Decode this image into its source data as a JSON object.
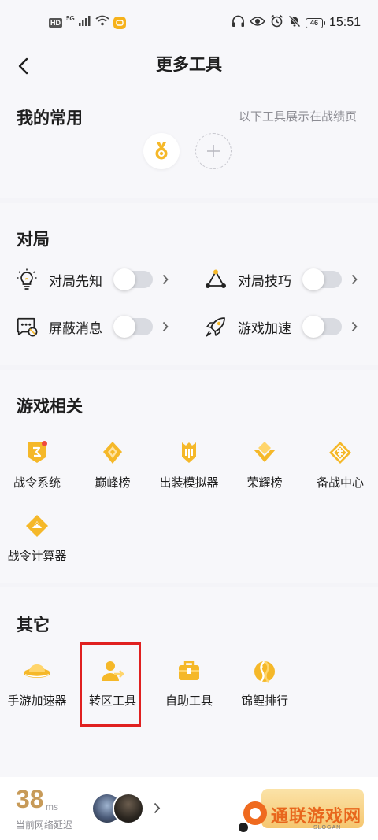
{
  "status_bar": {
    "hd": "HD",
    "net": "5G",
    "battery": "46",
    "time": "15:51"
  },
  "nav": {
    "title": "更多工具"
  },
  "favorites": {
    "title": "我的常用",
    "hint": "以下工具展示在战绩页"
  },
  "match": {
    "title": "对局",
    "rows": [
      {
        "label": "对局先知",
        "icon": "bulb-icon",
        "enabled": false
      },
      {
        "label": "对局技巧",
        "icon": "triangle-nodes-icon",
        "enabled": false
      },
      {
        "label": "屏蔽消息",
        "icon": "blocked-message-icon",
        "enabled": false
      },
      {
        "label": "游戏加速",
        "icon": "rocket-icon",
        "enabled": false
      }
    ]
  },
  "game_related": {
    "title": "游戏相关",
    "items": [
      {
        "label": "战令系统",
        "icon": "battle-pass-icon",
        "badge": true
      },
      {
        "label": "巅峰榜",
        "icon": "peak-rank-icon"
      },
      {
        "label": "出装模拟器",
        "icon": "build-simulator-icon"
      },
      {
        "label": "荣耀榜",
        "icon": "glory-rank-icon"
      },
      {
        "label": "备战中心",
        "icon": "prep-center-icon"
      },
      {
        "label": "战令计算器",
        "icon": "pass-calculator-icon"
      }
    ]
  },
  "others": {
    "title": "其它",
    "items": [
      {
        "label": "手游加速器",
        "icon": "accelerator-icon"
      },
      {
        "label": "转区工具",
        "icon": "transfer-icon"
      },
      {
        "label": "自助工具",
        "icon": "toolbox-icon"
      },
      {
        "label": "锦鲤排行",
        "icon": "koi-icon"
      }
    ]
  },
  "bottom": {
    "latency": "38",
    "latency_unit": "ms",
    "latency_label": "当前网络延迟"
  },
  "watermark": {
    "text": "通联游戏网",
    "slogan": "SLOGAN"
  },
  "colors": {
    "accent": "#f5b829",
    "highlight": "#e02020",
    "latency": "#c79a58"
  }
}
